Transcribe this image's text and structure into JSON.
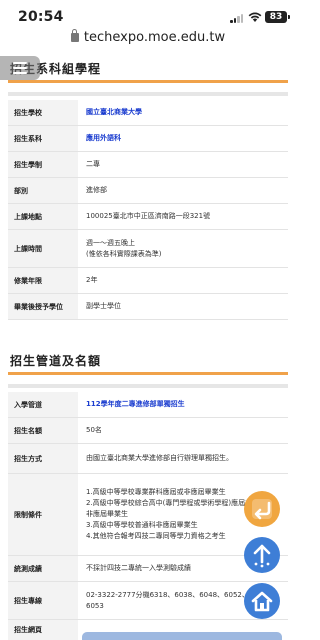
{
  "status_bar": {
    "time": "20:54",
    "battery": "83"
  },
  "browser": {
    "url": "techexpo.moe.edu.tw"
  },
  "section1": {
    "title": "招生系科組學程",
    "rows": [
      {
        "label": "招生學校",
        "value": [
          "國立臺北商業大學"
        ],
        "link": true
      },
      {
        "label": "招生系科",
        "value": [
          "應用外語科"
        ],
        "link": true
      },
      {
        "label": "招生學制",
        "value": [
          "二專"
        ],
        "link": false
      },
      {
        "label": "部別",
        "value": [
          "進修部"
        ],
        "link": false
      },
      {
        "label": "上課地點",
        "value": [
          "100025臺北市中正區濟南路一段321號"
        ],
        "link": false
      },
      {
        "label": "上課時間",
        "value": [
          "週一～週五晚上",
          "(惟依各科實際課表為準)"
        ],
        "link": false
      },
      {
        "label": "修業年限",
        "value": [
          "2年"
        ],
        "link": false
      },
      {
        "label": "畢業後授予學位",
        "value": [
          "副學士學位"
        ],
        "link": false
      }
    ]
  },
  "section2": {
    "title": "招生管道及名額",
    "rows": [
      {
        "label": "入學管道",
        "value": [
          "112學年度二專進修部單獨招生"
        ],
        "link": true
      },
      {
        "label": "招生名額",
        "value": [
          "50名"
        ],
        "link": false
      },
      {
        "label": "招生方式",
        "value": [
          "由國立臺北商業大學進修部自行辦理單獨招生。"
        ],
        "link": false
      },
      {
        "label": "限制條件",
        "value": [
          "1.高級中等學校專業群科應屆或非應屆畢業生",
          "2.高級中等學校綜合高中(專門學程或學術學程)應屆或",
          "非應屆畢業生",
          "3.高級中等學校普通科非應屆畢業生",
          "4.其他符合報考四技二專同等學力資格之考生"
        ],
        "link": false
      },
      {
        "label": "統測成績",
        "value": [
          "不採計四技二專統一入學測驗成績"
        ],
        "link": false
      },
      {
        "label": "招生專線",
        "value": [
          "02-3322-2777分機6318、6038、6048、6052、",
          "6053"
        ],
        "link": false
      },
      {
        "label": "招生網頁",
        "value": [
          ""
        ],
        "link": false
      }
    ]
  },
  "icons": {
    "menu": "hamburger-menu-icon",
    "back": "return-arrow-icon",
    "up": "scroll-top-icon",
    "home": "home-icon"
  },
  "colors": {
    "accent_orange": "#f0a24a",
    "link_blue": "#1a3ccf",
    "fab_blue": "#3e7ed6",
    "fab_orange": "#f0a640"
  }
}
